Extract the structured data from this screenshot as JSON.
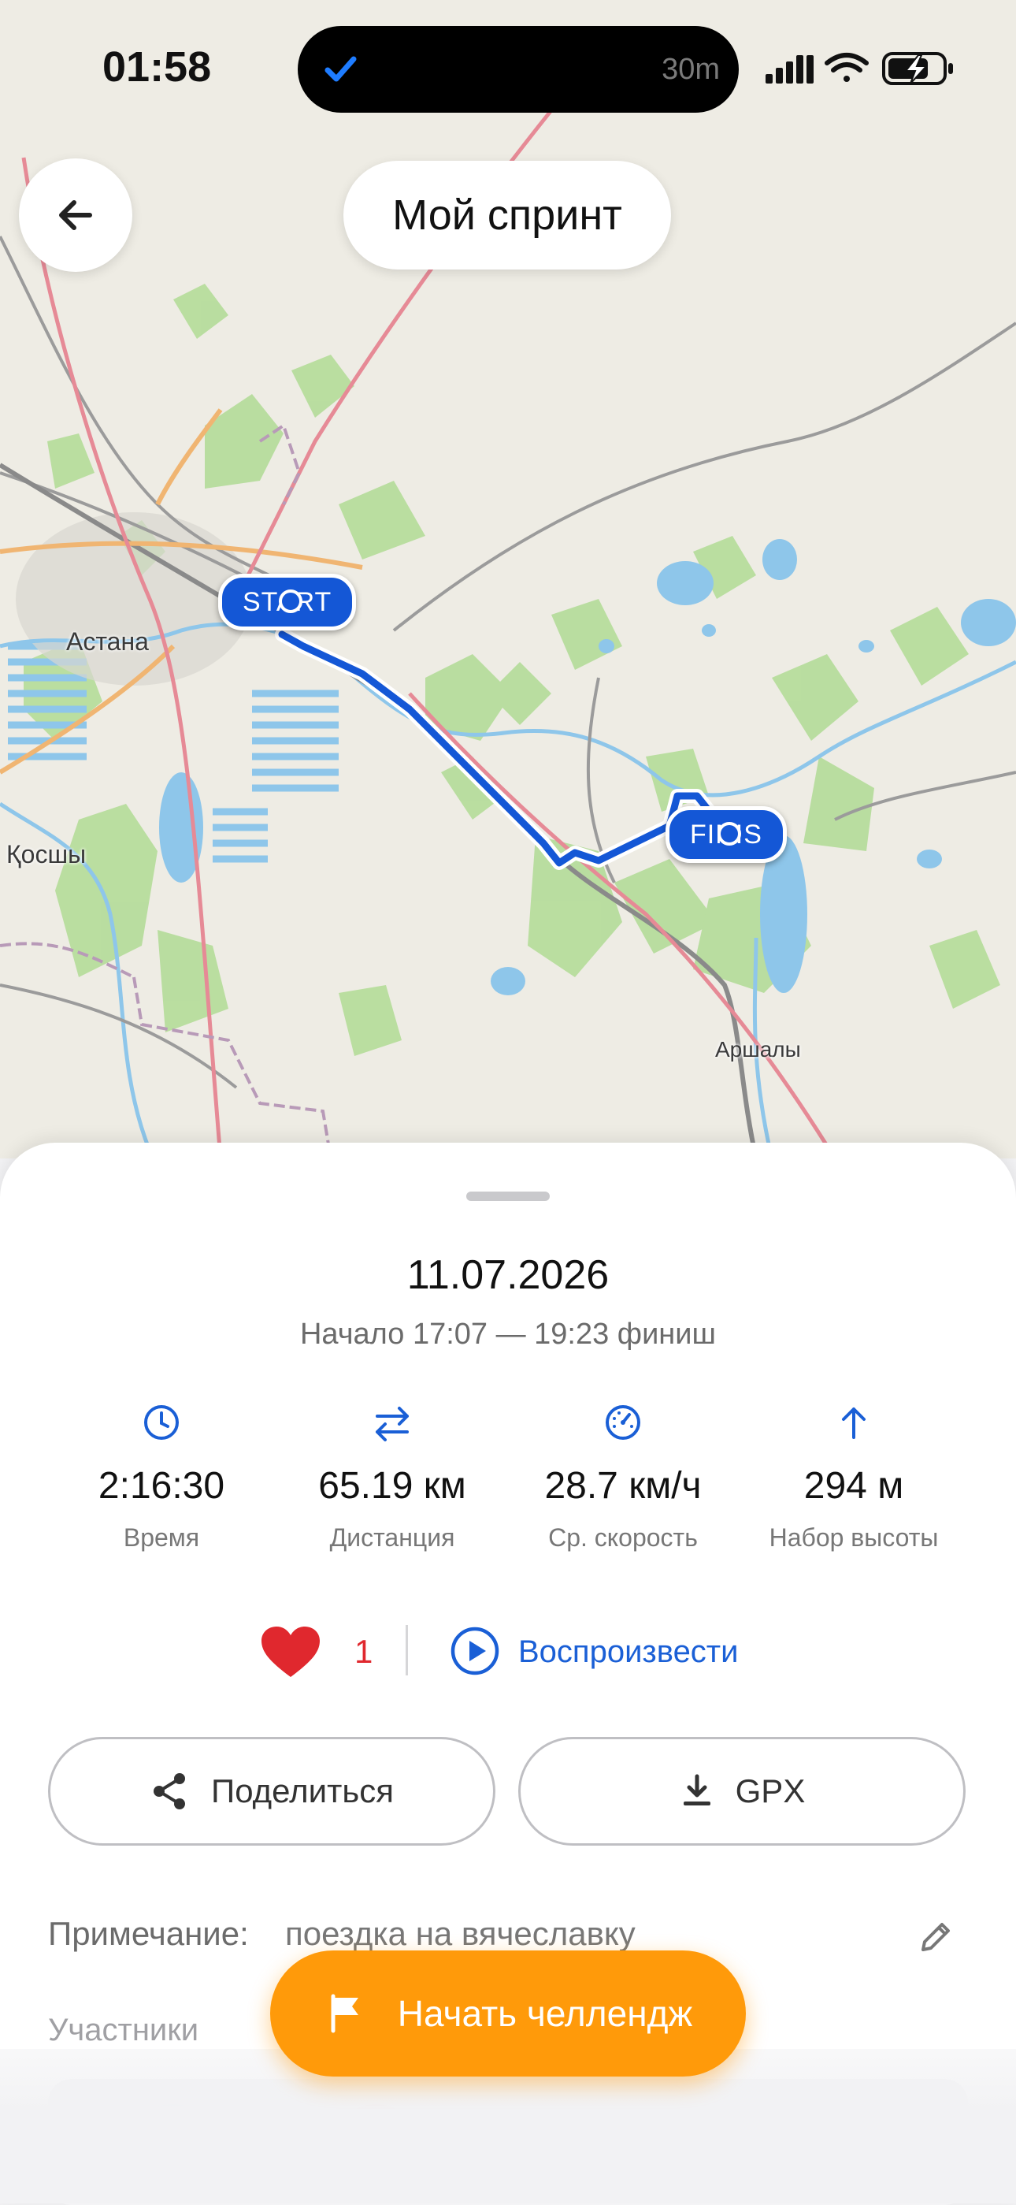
{
  "status_bar": {
    "time": "01:58",
    "activity_timer": "30m"
  },
  "header": {
    "title": "Мой спринт"
  },
  "map": {
    "labels": {
      "astana": "Астана",
      "kosshy": "Қосшы",
      "arshaly": "Аршалы"
    },
    "start_pin": "START",
    "finish_pin": "FINIS",
    "route_color": "#1457d6"
  },
  "summary": {
    "date": "11.07.2026",
    "time_range": "Начало 17:07 — 19:23 финиш",
    "stats": [
      {
        "icon": "clock-icon",
        "value": "2:16:30",
        "label": "Время"
      },
      {
        "icon": "distance-arrows-icon",
        "value": "65.19 км",
        "label": "Дистанция"
      },
      {
        "icon": "speedometer-icon",
        "value": "28.7 км/ч",
        "label": "Ср. скорость"
      },
      {
        "icon": "arrow-up-icon",
        "value": "294 м",
        "label": "Набор высоты"
      }
    ]
  },
  "actions": {
    "likes": "1",
    "play_label": "Воспроизвести",
    "share_label": "Поделиться",
    "gpx_label": "GPX"
  },
  "note": {
    "label": "Примечание:",
    "text": "поездка на вячеславку"
  },
  "participants": {
    "label": "Участники"
  },
  "fab": {
    "label": "Начать челлендж"
  },
  "colors": {
    "accent": "#1a5fd6",
    "orange": "#ff9a0a",
    "heart": "#e0282e"
  }
}
